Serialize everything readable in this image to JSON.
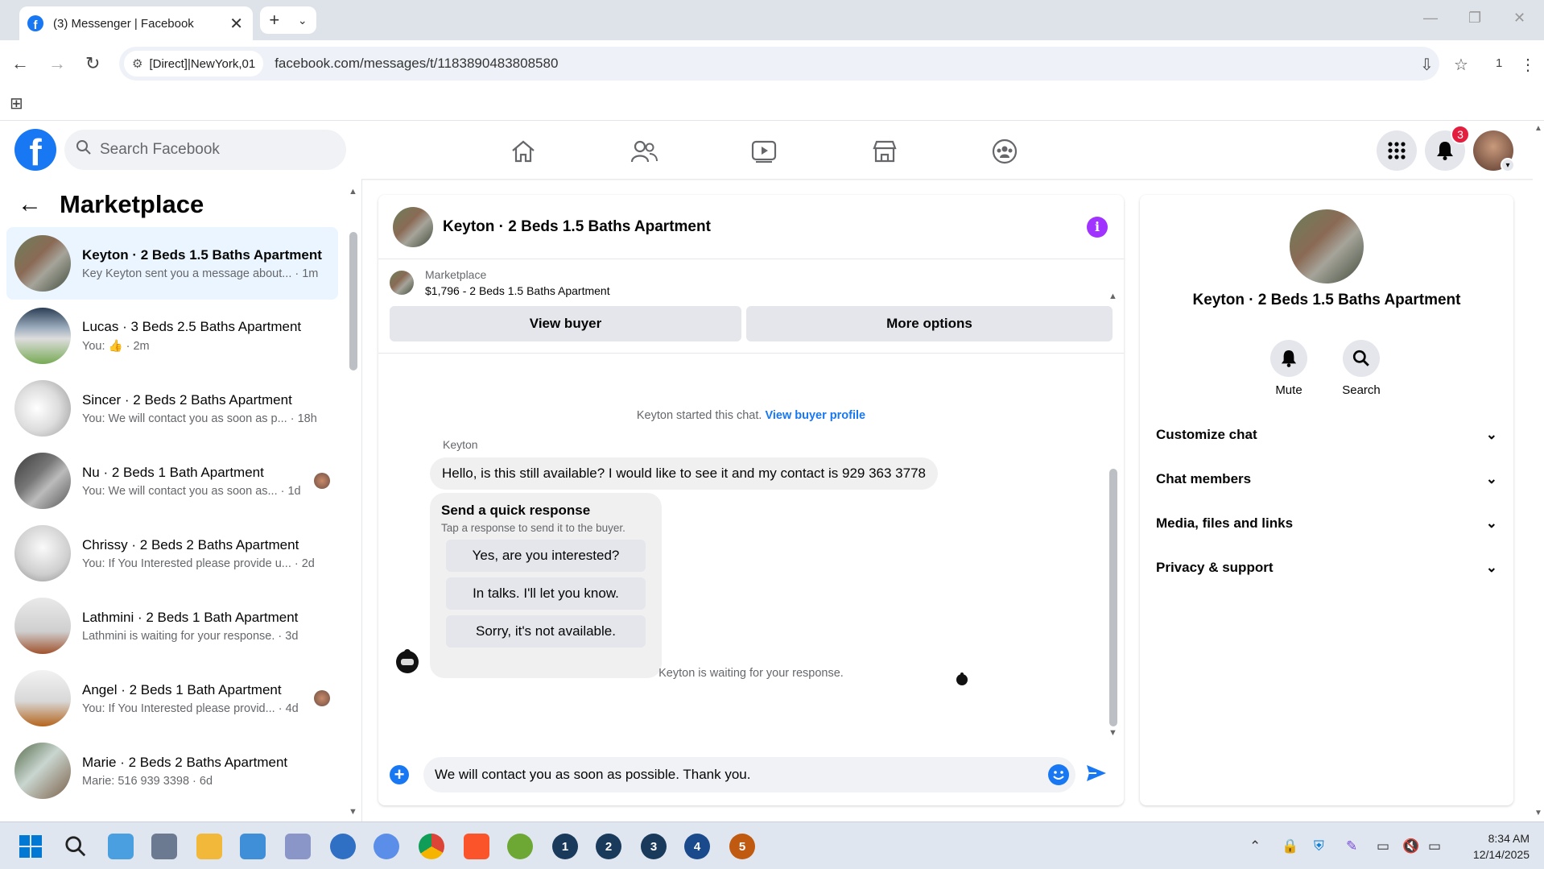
{
  "browser": {
    "tab_title": "(3) Messenger | Facebook",
    "address_chip": "[Direct]|NewYork,01",
    "url": "facebook.com/messages/t/1183890483808580",
    "profile_count": "1"
  },
  "fb": {
    "search_placeholder": "Search Facebook",
    "notification_count": "3"
  },
  "sidebar": {
    "title": "Marketplace",
    "conversations": [
      {
        "name": "Keyton · 2 Beds 1.5 Baths Apartment",
        "preview": "Key Keyton sent you a message about... · 1m",
        "active": true
      },
      {
        "name": "Lucas · 3 Beds 2.5 Baths Apartment",
        "preview": "You: 👍 · 2m"
      },
      {
        "name": "Sincer · 2 Beds 2 Baths Apartment",
        "preview": "You: We will contact you as soon as p... · 18h"
      },
      {
        "name": "Nu · 2 Beds 1 Bath Apartment",
        "preview": "You: We will contact you as soon as... · 1d"
      },
      {
        "name": "Chrissy · 2 Beds 2 Baths Apartment",
        "preview": "You: If You Interested please provide u... · 2d"
      },
      {
        "name": "Lathmini · 2 Beds 1 Bath Apartment",
        "preview": "Lathmini is waiting for your response. · 3d"
      },
      {
        "name": "Angel · 2 Beds 1 Bath Apartment",
        "preview": "You: If You Interested please provid... · 4d"
      },
      {
        "name": "Marie · 2 Beds 2 Baths Apartment",
        "preview": "Marie: 516 939 3398 · 6d"
      }
    ]
  },
  "chat": {
    "title": "Keyton · 2 Beds 1.5 Baths Apartment",
    "marketplace_label": "Marketplace",
    "listing": "$1,796 - 2 Beds 1.5 Baths Apartment",
    "view_buyer": "View buyer",
    "more_options": "More options",
    "started_text": "Keyton started this chat.",
    "view_profile": "View buyer profile",
    "sender": "Keyton",
    "message": "Hello, is this still available? I would like to see it and my contact is 929 363 3778",
    "quick_title": "Send a quick response",
    "quick_subtitle": "Tap a response to send it to the buyer.",
    "quick_options": [
      "Yes, are you interested?",
      "In talks. I'll let you know.",
      "Sorry, it's not available."
    ],
    "waiting_text": "Keyton is waiting for your response.",
    "composer_text": "We will contact you as soon as possible. Thank you."
  },
  "details": {
    "name": "Keyton · 2 Beds 1.5 Baths Apartment",
    "mute": "Mute",
    "search": "Search",
    "sections": [
      "Customize chat",
      "Chat members",
      "Media, files and links",
      "Privacy & support"
    ]
  },
  "taskbar": {
    "numbered_apps": [
      "1",
      "2",
      "3",
      "4",
      "5"
    ],
    "time": "8:34 AM",
    "date": "12/14/2025"
  },
  "colors": {
    "fb_blue": "#1877f2",
    "info_purple": "#a033ff",
    "badge_red": "#e41e3f"
  }
}
